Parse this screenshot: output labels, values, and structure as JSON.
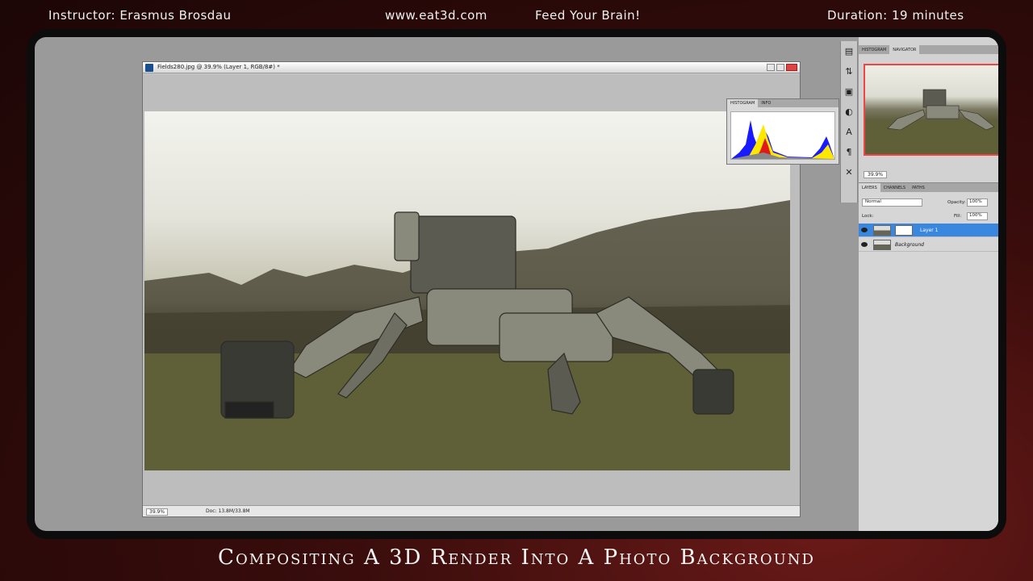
{
  "overlay": {
    "instructor": "Instructor: Erasmus Brosdau",
    "site": "www.eat3d.com",
    "slogan": "Feed Your Brain!",
    "duration": "Duration: 19 minutes",
    "course_title": "Compositing A 3D Render Into A Photo Background"
  },
  "document": {
    "title": "Fields280.jpg @ 39.9% (Layer 1, RGB/8#) *",
    "zoom": "39.9%",
    "doc_size": "Doc: 13.8M/33.8M"
  },
  "histogram_panel": {
    "tabs": [
      "HISTOGRAM",
      "INFO"
    ],
    "active_tab": "HISTOGRAM"
  },
  "navigator_panel": {
    "tabs": [
      "HISTOGRAM",
      "NAVIGATOR"
    ],
    "active_tab": "NAVIGATOR",
    "zoom": "39.9%"
  },
  "layers_panel": {
    "tabs": [
      "LAYERS",
      "CHANNELS",
      "PATHS"
    ],
    "active_tab": "LAYERS",
    "blend_mode": "Normal",
    "opacity_label": "Opacity:",
    "opacity_value": "100%",
    "lock_label": "Lock:",
    "fill_label": "Fill:",
    "fill_value": "100%",
    "layers": [
      {
        "name": "Layer 1",
        "selected": true
      },
      {
        "name": "Background",
        "selected": false
      }
    ]
  },
  "toolbar_icons": [
    "histogram-icon",
    "adjust-icon",
    "image-icon",
    "color-icon",
    "character-icon",
    "paragraph-icon",
    "tools-icon"
  ],
  "colors": {
    "selection_blue": "#3a87e0",
    "frame_red": "#6a1a18",
    "navigator_border": "#ee4444"
  }
}
